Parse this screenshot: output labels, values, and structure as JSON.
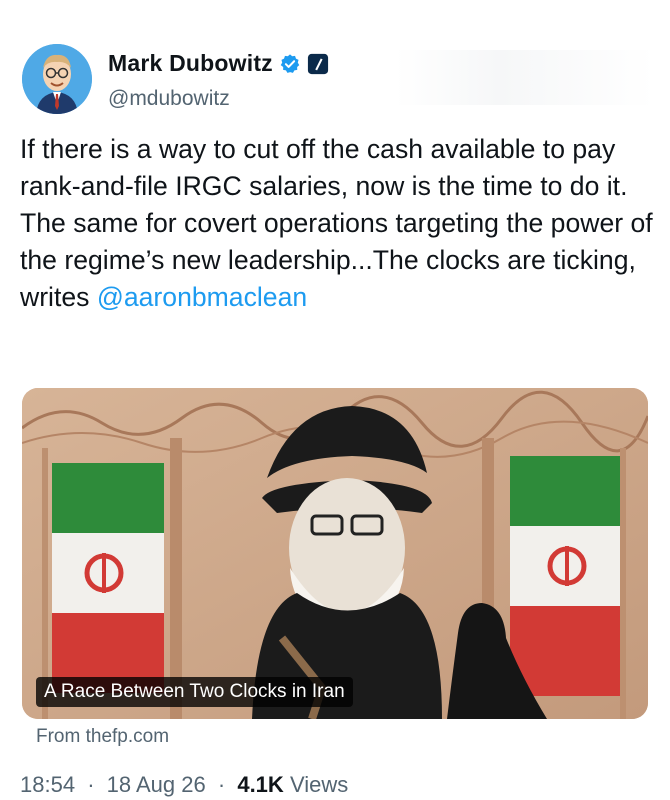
{
  "author": {
    "display_name": "Mark Dubowitz",
    "handle": "@mdubowitz",
    "verified_icon": "verified-badge-icon",
    "affiliation_icon": "affiliation-badge-icon"
  },
  "tweet": {
    "text": "If there is a way to cut off the cash available to pay rank-and-file IRGC salaries, now is the time to do it. The same for covert operations targeting the power of the regime’s new leadership...The clocks are ticking, writes",
    "mention": "@aaronbmaclean"
  },
  "card": {
    "title": "A Race Between Two Clocks in Iran",
    "source": "From thefp.com",
    "colors": {
      "flag_green": "#2e8b3a",
      "flag_red": "#d23a35",
      "wall": "#cfa88b"
    }
  },
  "meta": {
    "time": "18:54",
    "date": "18 Aug 26",
    "views_count": "4.1K",
    "views_label": "Views",
    "separator": "·"
  }
}
